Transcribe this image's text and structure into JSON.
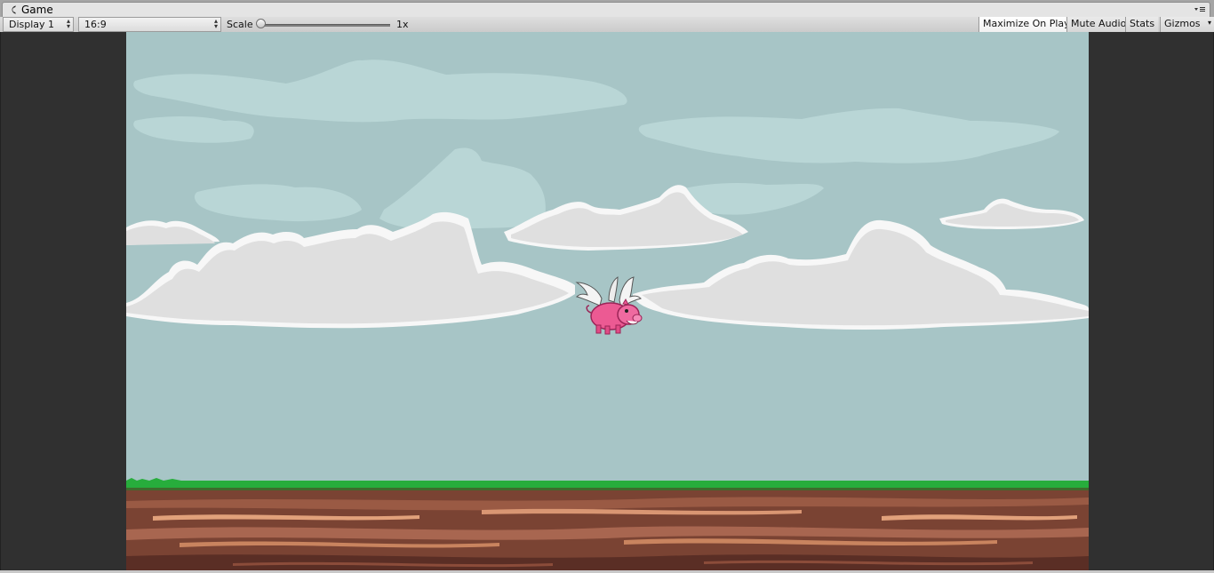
{
  "window": {
    "title": "Game"
  },
  "toolbar": {
    "display_label": "Display 1",
    "aspect_label": "16:9",
    "scale_label": "Scale",
    "scale_value": "1x",
    "maximize_label": "Maximize On Play",
    "mute_label": "Mute Audio",
    "stats_label": "Stats",
    "gizmos_label": "Gizmos"
  },
  "game": {
    "sky_color": "#a7c5c6",
    "cloud_color": "#e0e0e0",
    "far_cloud_color": "#b9d6d6",
    "grass_color": "#1f9e33",
    "dirt_color": "#7a4333",
    "player": "flying-pig"
  }
}
